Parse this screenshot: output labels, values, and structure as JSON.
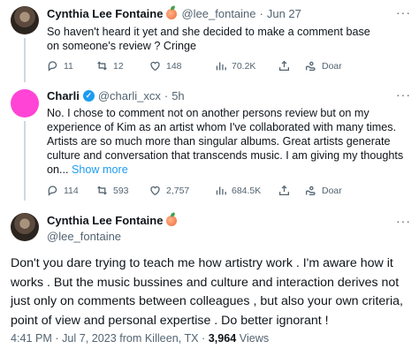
{
  "tweet1": {
    "name": "Cynthia Lee Fontaine",
    "handle": "@lee_fontaine",
    "separator": "·",
    "time": "Jun 27",
    "text": "So haven't heard it yet and she decided to make a comment base on someone's review ? Cringe",
    "replies": "11",
    "retweets": "12",
    "likes": "148",
    "views": "70.2K",
    "extra_label": "Doar",
    "more_icon": "···"
  },
  "tweet2": {
    "name": "Charli",
    "handle": "@charli_xcx",
    "separator": "·",
    "time": "5h",
    "text_lines": [
      "No. I chose to comment not on another persons review but on my",
      "experience of Kim as an artist whom I've collaborated with many times.",
      "Artists are so much more than singular albums. Great artists generate",
      "culture and conversation that transcends music. I am giving my thoughts",
      "on..."
    ],
    "show_more": "Show more",
    "replies": "114",
    "retweets": "593",
    "likes": "2,757",
    "views": "684.5K",
    "extra_label": "Doar",
    "more_icon": "···"
  },
  "tweet3": {
    "name": "Cynthia Lee Fontaine",
    "handle": "@lee_fontaine",
    "text_lines": [
      "Don't you dare trying to teach me how artistry work .  I'm aware how it",
      "works . But the music bussines and culture and interaction derives not",
      "just only on comments between colleagues , but also your own criteria,",
      "point of view and personal expertise .  Do better ignorant !"
    ],
    "timestamp": "4:41 PM · Jul 7, 2023 from Killeen, TX · ",
    "views_count": "3,964",
    "views_label": "Views",
    "more_icon": "···"
  }
}
